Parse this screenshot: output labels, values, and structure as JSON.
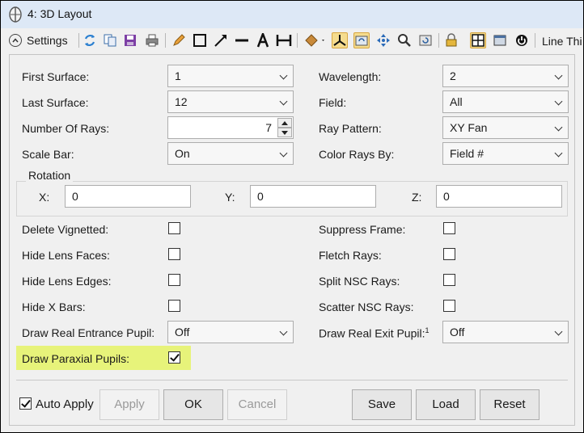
{
  "window": {
    "title": "4: 3D Layout"
  },
  "toolbar": {
    "settings_label": "Settings",
    "line_label": "Line Thi"
  },
  "fields": {
    "first_surface": {
      "label": "First Surface:",
      "value": "1"
    },
    "last_surface": {
      "label": "Last Surface:",
      "value": "12"
    },
    "number_of_rays": {
      "label": "Number Of Rays:",
      "value": "7"
    },
    "scale_bar": {
      "label": "Scale Bar:",
      "value": "On"
    },
    "wavelength": {
      "label": "Wavelength:",
      "value": "2"
    },
    "field": {
      "label": "Field:",
      "value": "All"
    },
    "ray_pattern": {
      "label": "Ray Pattern:",
      "value": "XY Fan"
    },
    "color_rays_by": {
      "label": "Color Rays By:",
      "value": "Field #"
    }
  },
  "rotation": {
    "title": "Rotation",
    "x": {
      "label": "X:",
      "value": "0"
    },
    "y": {
      "label": "Y:",
      "value": "0"
    },
    "z": {
      "label": "Z:",
      "value": "0"
    }
  },
  "checks": {
    "delete_vignetted": {
      "label": "Delete Vignetted:",
      "checked": false
    },
    "hide_lens_faces": {
      "label": "Hide Lens Faces:",
      "checked": false
    },
    "hide_lens_edges": {
      "label": "Hide Lens Edges:",
      "checked": false
    },
    "hide_x_bars": {
      "label": "Hide X Bars:",
      "checked": false
    },
    "suppress_frame": {
      "label": "Suppress Frame:",
      "checked": false
    },
    "fletch_rays": {
      "label": "Fletch Rays:",
      "checked": false
    },
    "split_nsc_rays": {
      "label": "Split NSC Rays:",
      "checked": false
    },
    "scatter_nsc_rays": {
      "label": "Scatter NSC Rays:",
      "checked": false
    },
    "draw_paraxial_pupils": {
      "label": "Draw Paraxial Pupils:",
      "checked": true
    }
  },
  "pupils": {
    "entrance": {
      "label": "Draw Real Entrance Pupil:",
      "value": "Off"
    },
    "exit": {
      "label": "Draw Real Exit Pupil:",
      "superscript": "1",
      "value": "Off"
    }
  },
  "footer": {
    "auto_apply_label": "Auto Apply",
    "apply": "Apply",
    "ok": "OK",
    "cancel": "Cancel",
    "save": "Save",
    "load": "Load",
    "reset": "Reset"
  },
  "colors": {
    "titlebar": "#dde8f6",
    "highlight": "#e7f37a",
    "active_tool": "#f5dc8e"
  }
}
